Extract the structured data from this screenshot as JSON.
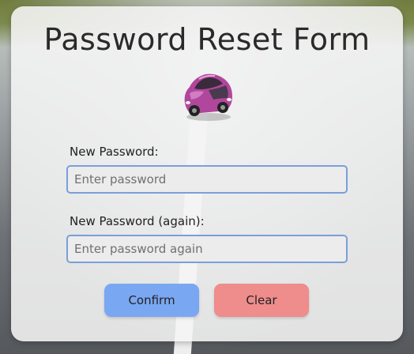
{
  "form": {
    "title": "Password Reset Form",
    "icon": "car-icon",
    "fields": [
      {
        "label": "New Password:",
        "placeholder": "Enter password",
        "value": ""
      },
      {
        "label": "New Password (again):",
        "placeholder": "Enter password again",
        "value": ""
      }
    ],
    "buttons": {
      "confirm_label": "Confirm",
      "clear_label": "Clear"
    },
    "colors": {
      "confirm": "#7aa7f2",
      "clear": "#ef8c8c",
      "input_border": "#7a9fd8"
    }
  }
}
